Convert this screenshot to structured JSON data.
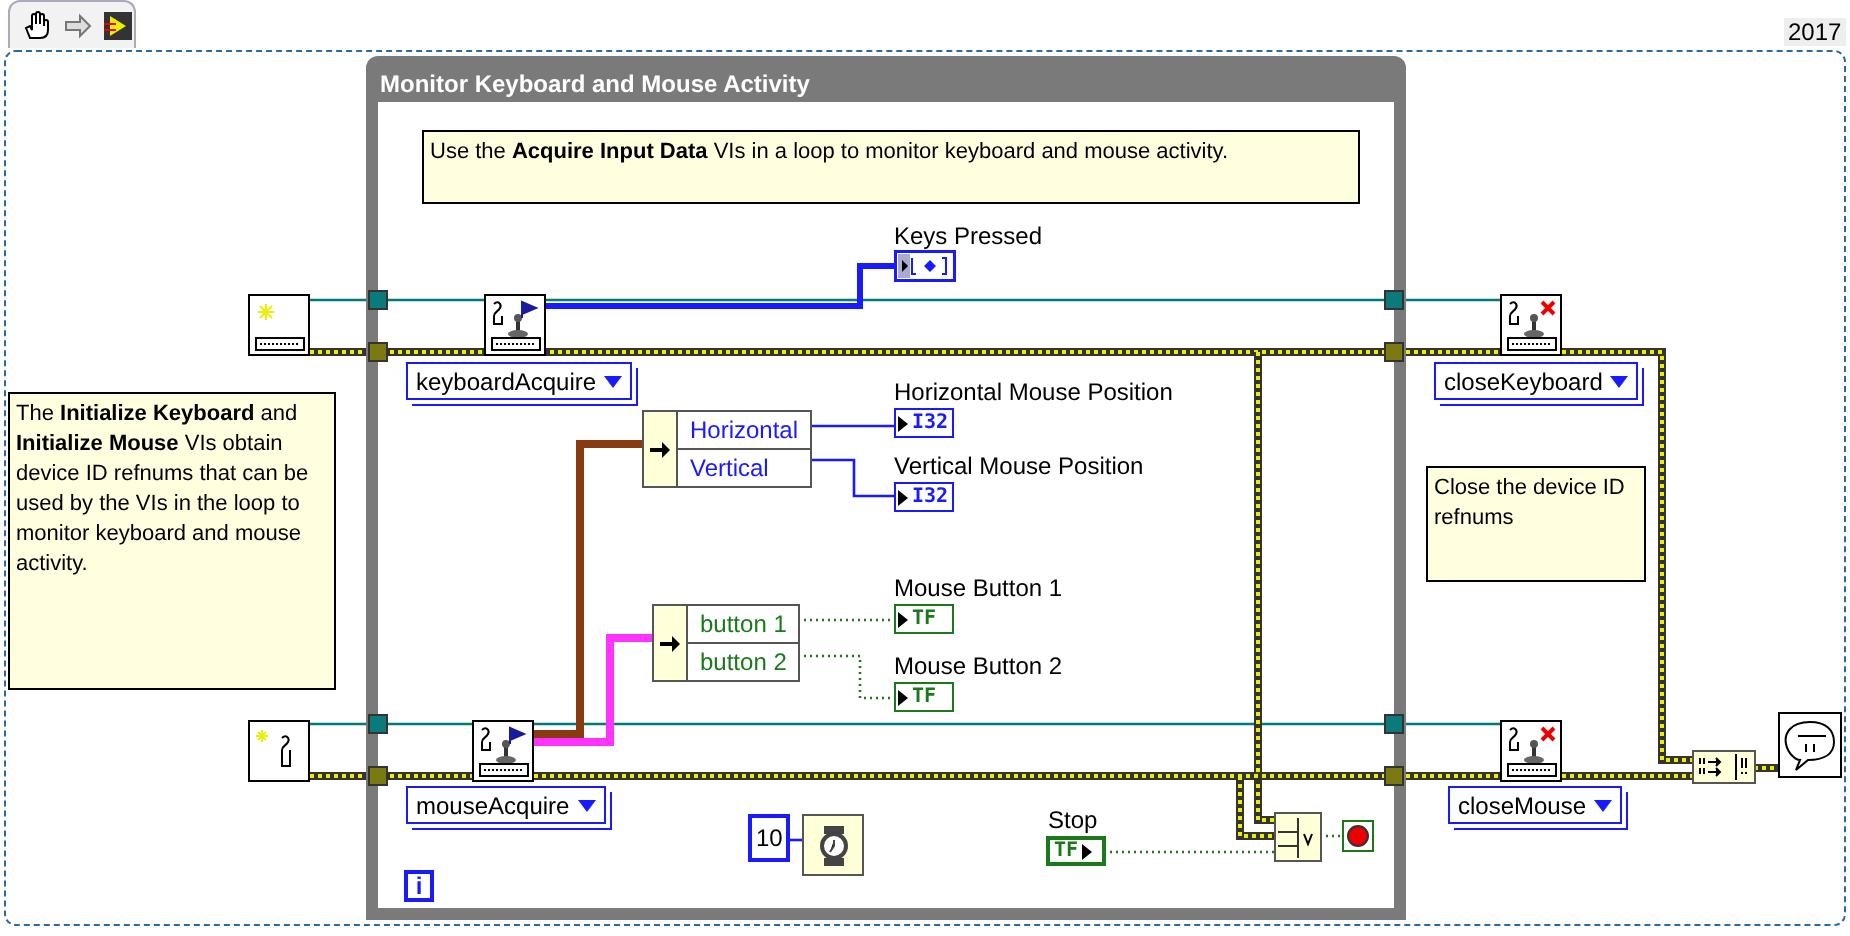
{
  "version": "2017",
  "loop": {
    "title": "Monitor Keyboard and Mouse Activity",
    "iteration": "i",
    "note": "Use the **Acquire Input Data** VIs in a loop to monitor keyboard and mouse activity."
  },
  "notes": [
    "The **Initialize Keyboard** and **Initialize Mouse** VIs obtain device ID refnums that can be used by the VIs in the loop to monitor keyboard and mouse activity.",
    "Close the device ID refnums"
  ],
  "selectors": [
    "keyboardAcquire",
    "mouseAcquire",
    "closeKeyboard",
    "closeMouse"
  ],
  "unbundles": [
    {
      "kind": "numeric",
      "fields": [
        "Horizontal",
        "Vertical"
      ]
    },
    {
      "kind": "boolean",
      "fields": [
        "button 1",
        "button 2"
      ]
    }
  ],
  "indicators": [
    {
      "label": "Keys Pressed",
      "kind": "array"
    },
    {
      "label": "Horizontal Mouse Position",
      "kind": "numeric",
      "type": "I32"
    },
    {
      "label": "Vertical Mouse Position",
      "kind": "numeric",
      "type": "I32"
    },
    {
      "label": "Mouse Button 1",
      "kind": "boolean",
      "type": "TF"
    },
    {
      "label": "Mouse Button 2",
      "kind": "boolean",
      "type": "TF"
    }
  ],
  "wait_constant": "10",
  "stop_control": {
    "label": "Stop",
    "type": "TF"
  }
}
